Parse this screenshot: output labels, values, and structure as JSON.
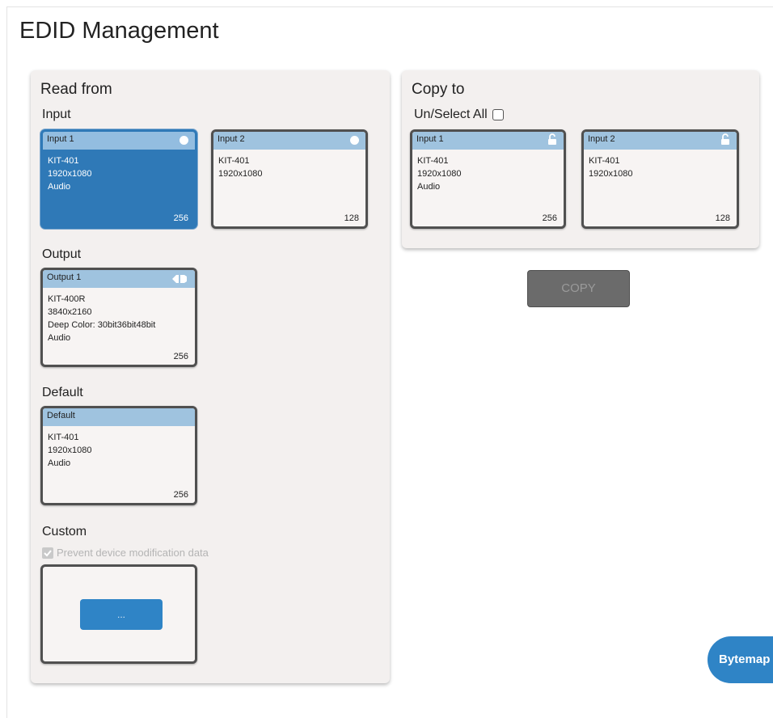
{
  "page": {
    "title": "EDID Management"
  },
  "read_from": {
    "title": "Read from",
    "input_label": "Input",
    "inputs": [
      {
        "name": "Input 1",
        "device": "KIT-401",
        "resolution": "1920x1080",
        "audio": "Audio",
        "size": "256",
        "selected": true
      },
      {
        "name": "Input 2",
        "device": "KIT-401",
        "resolution": "1920x1080",
        "size": "128",
        "selected": false
      }
    ],
    "output_label": "Output",
    "output": {
      "name": "Output 1",
      "device": "KIT-400R",
      "resolution": "3840x2160",
      "deep_color": "Deep Color: 30bit36bit48bit",
      "audio": "Audio",
      "size": "256"
    },
    "default_label": "Default",
    "default": {
      "name": "Default",
      "device": "KIT-401",
      "resolution": "1920x1080",
      "audio": "Audio",
      "size": "256"
    },
    "custom_label": "Custom",
    "prevent_label": "Prevent device modification data",
    "custom_button": "..."
  },
  "copy_to": {
    "title": "Copy to",
    "select_all_label": "Un/Select All",
    "inputs": [
      {
        "name": "Input 1",
        "device": "KIT-401",
        "resolution": "1920x1080",
        "audio": "Audio",
        "size": "256"
      },
      {
        "name": "Input 2",
        "device": "KIT-401",
        "resolution": "1920x1080",
        "size": "128"
      }
    ],
    "copy_button": "COPY"
  },
  "bytemap_button": "Bytemap",
  "colors": {
    "accent": "#2f79b7",
    "card_header": "#9fc3df",
    "panel": "#f3f0ef",
    "copy_disabled": "#6b6b6b"
  },
  "icons": {
    "selected_dot": "circle-icon",
    "lock": "unlock-icon",
    "output_connector": "hdmi-connector-icon"
  }
}
